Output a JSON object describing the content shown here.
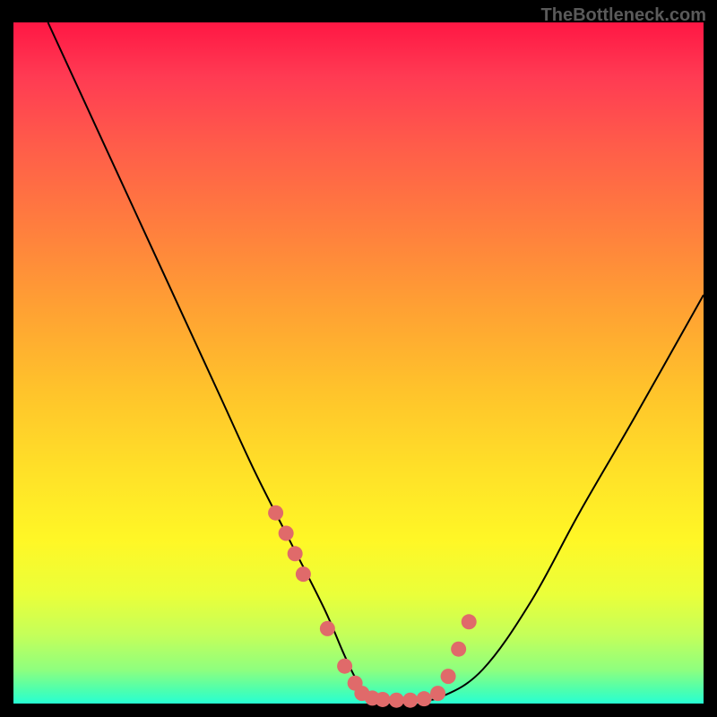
{
  "watermark": "TheBottleneck.com",
  "chart_data": {
    "type": "line",
    "title": "",
    "xlabel": "",
    "ylabel": "",
    "xlim": [
      0,
      100
    ],
    "ylim": [
      0,
      100
    ],
    "series": [
      {
        "name": "bottleneck-curve",
        "x": [
          5,
          10,
          15,
          20,
          25,
          30,
          35,
          40,
          45,
          48,
          50,
          52,
          55,
          58,
          62,
          68,
          75,
          82,
          90,
          100
        ],
        "values": [
          100,
          89,
          78,
          67,
          56,
          45,
          34,
          24,
          14,
          7,
          3,
          1,
          0.5,
          0.5,
          1,
          5,
          15,
          28,
          42,
          60
        ]
      }
    ],
    "markers": {
      "name": "highlight-dots",
      "color": "#e06a6a",
      "x": [
        38.0,
        39.5,
        40.8,
        42.0,
        45.5,
        48.0,
        49.5,
        50.5,
        52.0,
        53.5,
        55.5,
        57.5,
        59.5,
        61.5,
        63.0,
        64.5,
        66.0
      ],
      "values": [
        28.0,
        25.0,
        22.0,
        19.0,
        11.0,
        5.5,
        3.0,
        1.5,
        0.8,
        0.6,
        0.5,
        0.5,
        0.7,
        1.5,
        4.0,
        8.0,
        12.0
      ]
    },
    "background_gradient": {
      "top": "#ff1744",
      "mid": "#ffe128",
      "bottom": "#27ffd3"
    }
  }
}
